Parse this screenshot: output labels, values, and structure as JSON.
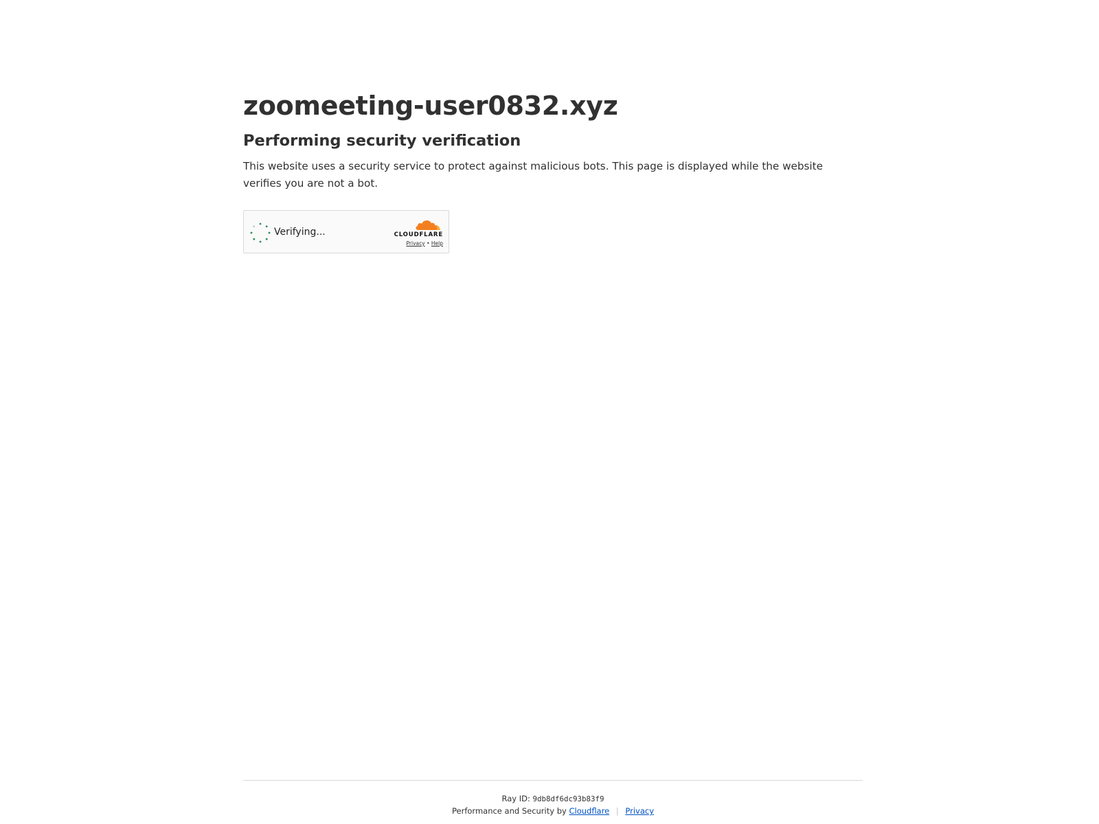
{
  "page": {
    "site_title": "zoomeeting-user0832.xyz",
    "subtitle": "Performing security verification",
    "description": "This website uses a security service to protect against malicious bots. This page is displayed while the website verifies you are not a bot."
  },
  "widget": {
    "status_text": "Verifying...",
    "brand_name": "CLOUDFLARE",
    "privacy_label": "Privacy",
    "separator": "•",
    "help_label": "Help",
    "spinner_icon": "loading-spinner-icon",
    "logo_icon": "cloudflare-cloud-icon"
  },
  "footer": {
    "ray_label": "Ray ID:",
    "ray_id": "9db8df6dc93b83f9",
    "performance_text": "Performance and Security by",
    "cloudflare_link": "Cloudflare",
    "divider": "|",
    "privacy_link": "Privacy"
  },
  "colors": {
    "text": "#313131",
    "spinner_green": "#2f8a5b",
    "cloudflare_orange": "#f38020",
    "cloudflare_light_orange": "#faae40",
    "link_blue": "#0051c3"
  }
}
